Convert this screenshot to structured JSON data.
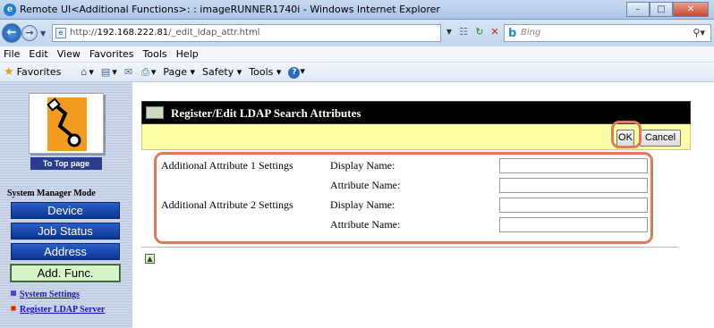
{
  "window": {
    "title": "Remote UI<Additional Functions>: : imageRUNNER1740i - Windows Internet Explorer",
    "minimize": "–",
    "maximize": "□",
    "close": "✕"
  },
  "addressbar": {
    "url_prefix": "http://",
    "url_host": "192.168.222.81",
    "url_path": "/_edit_ldap_attr.html",
    "search_placeholder": "Bing",
    "search_logo": "b",
    "search_icon": "search-icon",
    "back_icon": "back-arrow-icon",
    "forward_icon": "forward-arrow-icon"
  },
  "menubar": {
    "items": [
      "File",
      "Edit",
      "View",
      "Favorites",
      "Tools",
      "Help"
    ]
  },
  "favbar": {
    "favorites": "Favorites",
    "page": "Page",
    "safety": "Safety",
    "tools": "Tools"
  },
  "leftnav": {
    "to_top": "To Top page",
    "mode_title": "System Manager Mode",
    "buttons": [
      "Device",
      "Job Status",
      "Address",
      "Add. Func."
    ],
    "links": [
      "System Settings",
      "Register LDAP Server"
    ]
  },
  "panel": {
    "title": "Register/Edit LDAP Search Attributes",
    "ok_label": "OK",
    "cancel_label": "Cancel",
    "rows": [
      {
        "section": "Additional Attribute 1 Settings",
        "field": "Display Name:",
        "value": ""
      },
      {
        "section": "",
        "field": "Attribute Name:",
        "value": ""
      },
      {
        "section": "Additional Attribute 2 Settings",
        "field": "Display Name:",
        "value": ""
      },
      {
        "section": "",
        "field": "Attribute Name:",
        "value": ""
      }
    ]
  },
  "colors": {
    "header_bg": "#000000",
    "bar_bg": "#ffffa5",
    "highlight_ring": "#e07b5a",
    "nav_button": "#1a48b0",
    "nav_active": "#d8f5c8"
  }
}
